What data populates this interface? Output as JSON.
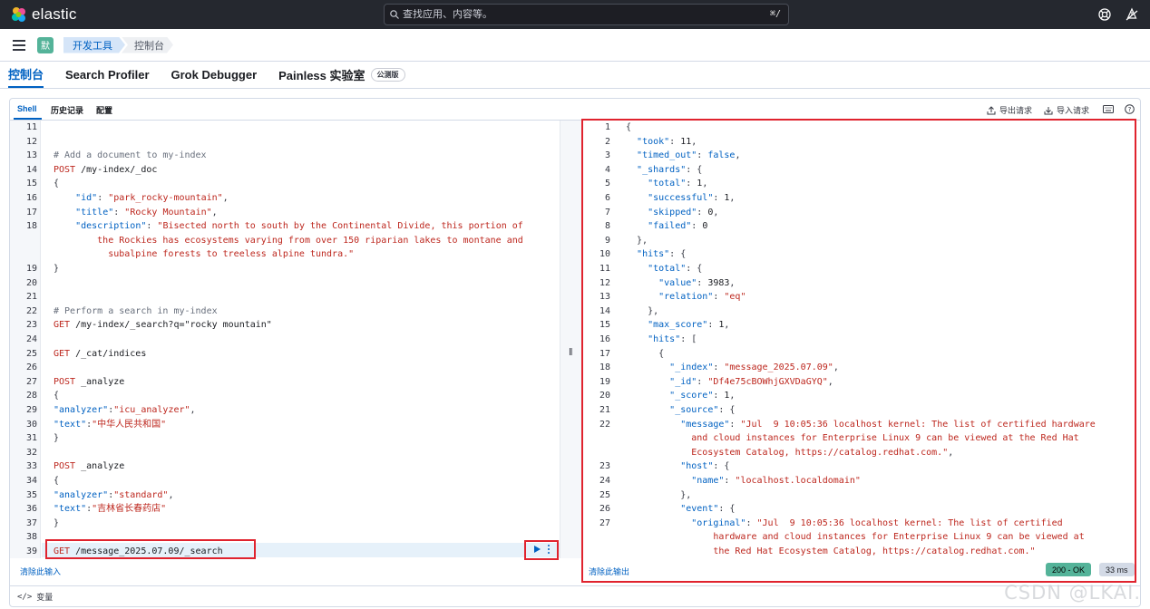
{
  "app": {
    "logo_text": "elastic"
  },
  "search": {
    "placeholder": "查找应用、内容等。",
    "shortcut": "⌘/"
  },
  "breadcrumbs": {
    "space_initial": "默",
    "items": [
      "开发工具",
      "控制台"
    ]
  },
  "tabs": [
    {
      "label": "控制台",
      "active": true
    },
    {
      "label": "Search Profiler",
      "active": false
    },
    {
      "label": "Grok Debugger",
      "active": false
    },
    {
      "label": "Painless 实验室",
      "active": false,
      "badge": "公测版"
    }
  ],
  "console_tabs": [
    {
      "label": "Shell",
      "active": true
    },
    {
      "label": "历史记录",
      "active": false
    },
    {
      "label": "配置",
      "active": false
    }
  ],
  "console_actions": {
    "export": "导出请求",
    "import": "导入请求"
  },
  "editor": {
    "lines": [
      {
        "n": "11",
        "segs": []
      },
      {
        "n": "12",
        "segs": []
      },
      {
        "n": "13",
        "segs": [
          [
            "c-comment",
            "# Add a document to my-index"
          ]
        ]
      },
      {
        "n": "14",
        "segs": [
          [
            "c-method",
            "POST"
          ],
          [
            "c-url",
            " /my-index/_doc"
          ]
        ]
      },
      {
        "n": "15",
        "segs": [
          [
            "c-punc",
            "{"
          ]
        ]
      },
      {
        "n": "16",
        "segs": [
          [
            "c-punc",
            "    "
          ],
          [
            "c-key",
            "\"id\""
          ],
          [
            "c-punc",
            ": "
          ],
          [
            "c-str",
            "\"park_rocky-mountain\""
          ],
          [
            "c-punc",
            ","
          ]
        ]
      },
      {
        "n": "17",
        "segs": [
          [
            "c-punc",
            "    "
          ],
          [
            "c-key",
            "\"title\""
          ],
          [
            "c-punc",
            ": "
          ],
          [
            "c-str",
            "\"Rocky Mountain\""
          ],
          [
            "c-punc",
            ","
          ]
        ]
      },
      {
        "n": "18",
        "segs": [
          [
            "c-punc",
            "    "
          ],
          [
            "c-key",
            "\"description\""
          ],
          [
            "c-punc",
            ": "
          ],
          [
            "c-str",
            "\"Bisected north to south by the Continental Divide, this portion of"
          ]
        ]
      },
      {
        "n": "",
        "segs": [
          [
            "c-str",
            "        the Rockies has ecosystems varying from over 150 riparian lakes to montane and"
          ]
        ]
      },
      {
        "n": "",
        "segs": [
          [
            "c-str",
            "          subalpine forests to treeless alpine tundra.\""
          ]
        ]
      },
      {
        "n": "19",
        "segs": [
          [
            "c-punc",
            "}"
          ]
        ]
      },
      {
        "n": "20",
        "segs": []
      },
      {
        "n": "21",
        "segs": []
      },
      {
        "n": "22",
        "segs": [
          [
            "c-comment",
            "# Perform a search in my-index"
          ]
        ]
      },
      {
        "n": "23",
        "segs": [
          [
            "c-method",
            "GET"
          ],
          [
            "c-url",
            " /my-index/_search?q=\"rocky mountain\""
          ]
        ]
      },
      {
        "n": "24",
        "segs": []
      },
      {
        "n": "25",
        "segs": [
          [
            "c-method",
            "GET"
          ],
          [
            "c-url",
            " /_cat/indices"
          ]
        ]
      },
      {
        "n": "26",
        "segs": []
      },
      {
        "n": "27",
        "segs": [
          [
            "c-method",
            "POST"
          ],
          [
            "c-url",
            " _analyze"
          ]
        ]
      },
      {
        "n": "28",
        "segs": [
          [
            "c-punc",
            "{"
          ]
        ]
      },
      {
        "n": "29",
        "segs": [
          [
            "c-key",
            "\"analyzer\""
          ],
          [
            "c-punc",
            ":"
          ],
          [
            "c-str",
            "\"icu_analyzer\""
          ],
          [
            "c-punc",
            ","
          ]
        ]
      },
      {
        "n": "30",
        "segs": [
          [
            "c-key",
            "\"text\""
          ],
          [
            "c-punc",
            ":"
          ],
          [
            "c-str",
            "\"中华人民共和国\""
          ]
        ]
      },
      {
        "n": "31",
        "segs": [
          [
            "c-punc",
            "}"
          ]
        ]
      },
      {
        "n": "32",
        "segs": []
      },
      {
        "n": "33",
        "segs": [
          [
            "c-method",
            "POST"
          ],
          [
            "c-url",
            " _analyze"
          ]
        ]
      },
      {
        "n": "34",
        "segs": [
          [
            "c-punc",
            "{"
          ]
        ]
      },
      {
        "n": "35",
        "segs": [
          [
            "c-key",
            "\"analyzer\""
          ],
          [
            "c-punc",
            ":"
          ],
          [
            "c-str",
            "\"standard\""
          ],
          [
            "c-punc",
            ","
          ]
        ]
      },
      {
        "n": "36",
        "segs": [
          [
            "c-key",
            "\"text\""
          ],
          [
            "c-punc",
            ":"
          ],
          [
            "c-str",
            "\"吉林省长春药店\""
          ]
        ]
      },
      {
        "n": "37",
        "segs": [
          [
            "c-punc",
            "}"
          ]
        ]
      },
      {
        "n": "38",
        "segs": []
      },
      {
        "n": "39",
        "segs": [
          [
            "c-method",
            "GET"
          ],
          [
            "c-url",
            " /message_2025.07.09/_search"
          ]
        ]
      }
    ],
    "clear_label": "清除此输入"
  },
  "output": {
    "lines": [
      {
        "n": "1",
        "segs": [
          [
            "c-punc",
            "{"
          ]
        ]
      },
      {
        "n": "2",
        "segs": [
          [
            "c-punc",
            "  "
          ],
          [
            "c-key",
            "\"took\""
          ],
          [
            "c-punc",
            ": "
          ],
          [
            "c-num",
            "11"
          ],
          [
            "c-punc",
            ","
          ]
        ]
      },
      {
        "n": "3",
        "segs": [
          [
            "c-punc",
            "  "
          ],
          [
            "c-key",
            "\"timed_out\""
          ],
          [
            "c-punc",
            ": "
          ],
          [
            "c-bool",
            "false"
          ],
          [
            "c-punc",
            ","
          ]
        ]
      },
      {
        "n": "4",
        "segs": [
          [
            "c-punc",
            "  "
          ],
          [
            "c-key",
            "\"_shards\""
          ],
          [
            "c-punc",
            ": {"
          ]
        ]
      },
      {
        "n": "5",
        "segs": [
          [
            "c-punc",
            "    "
          ],
          [
            "c-key",
            "\"total\""
          ],
          [
            "c-punc",
            ": "
          ],
          [
            "c-num",
            "1"
          ],
          [
            "c-punc",
            ","
          ]
        ]
      },
      {
        "n": "6",
        "segs": [
          [
            "c-punc",
            "    "
          ],
          [
            "c-key",
            "\"successful\""
          ],
          [
            "c-punc",
            ": "
          ],
          [
            "c-num",
            "1"
          ],
          [
            "c-punc",
            ","
          ]
        ]
      },
      {
        "n": "7",
        "segs": [
          [
            "c-punc",
            "    "
          ],
          [
            "c-key",
            "\"skipped\""
          ],
          [
            "c-punc",
            ": "
          ],
          [
            "c-num",
            "0"
          ],
          [
            "c-punc",
            ","
          ]
        ]
      },
      {
        "n": "8",
        "segs": [
          [
            "c-punc",
            "    "
          ],
          [
            "c-key",
            "\"failed\""
          ],
          [
            "c-punc",
            ": "
          ],
          [
            "c-num",
            "0"
          ]
        ]
      },
      {
        "n": "9",
        "segs": [
          [
            "c-punc",
            "  },"
          ]
        ]
      },
      {
        "n": "10",
        "segs": [
          [
            "c-punc",
            "  "
          ],
          [
            "c-key",
            "\"hits\""
          ],
          [
            "c-punc",
            ": {"
          ]
        ]
      },
      {
        "n": "11",
        "segs": [
          [
            "c-punc",
            "    "
          ],
          [
            "c-key",
            "\"total\""
          ],
          [
            "c-punc",
            ": {"
          ]
        ]
      },
      {
        "n": "12",
        "segs": [
          [
            "c-punc",
            "      "
          ],
          [
            "c-key",
            "\"value\""
          ],
          [
            "c-punc",
            ": "
          ],
          [
            "c-num",
            "3983"
          ],
          [
            "c-punc",
            ","
          ]
        ]
      },
      {
        "n": "13",
        "segs": [
          [
            "c-punc",
            "      "
          ],
          [
            "c-key",
            "\"relation\""
          ],
          [
            "c-punc",
            ": "
          ],
          [
            "c-str",
            "\"eq\""
          ]
        ]
      },
      {
        "n": "14",
        "segs": [
          [
            "c-punc",
            "    },"
          ]
        ]
      },
      {
        "n": "15",
        "segs": [
          [
            "c-punc",
            "    "
          ],
          [
            "c-key",
            "\"max_score\""
          ],
          [
            "c-punc",
            ": "
          ],
          [
            "c-num",
            "1"
          ],
          [
            "c-punc",
            ","
          ]
        ]
      },
      {
        "n": "16",
        "segs": [
          [
            "c-punc",
            "    "
          ],
          [
            "c-key",
            "\"hits\""
          ],
          [
            "c-punc",
            ": ["
          ]
        ]
      },
      {
        "n": "17",
        "segs": [
          [
            "c-punc",
            "      {"
          ]
        ]
      },
      {
        "n": "18",
        "segs": [
          [
            "c-punc",
            "        "
          ],
          [
            "c-key",
            "\"_index\""
          ],
          [
            "c-punc",
            ": "
          ],
          [
            "c-str",
            "\"message_2025.07.09\""
          ],
          [
            "c-punc",
            ","
          ]
        ]
      },
      {
        "n": "19",
        "segs": [
          [
            "c-punc",
            "        "
          ],
          [
            "c-key",
            "\"_id\""
          ],
          [
            "c-punc",
            ": "
          ],
          [
            "c-str",
            "\"Df4e75cBOWhjGXVDaGYQ\""
          ],
          [
            "c-punc",
            ","
          ]
        ]
      },
      {
        "n": "20",
        "segs": [
          [
            "c-punc",
            "        "
          ],
          [
            "c-key",
            "\"_score\""
          ],
          [
            "c-punc",
            ": "
          ],
          [
            "c-num",
            "1"
          ],
          [
            "c-punc",
            ","
          ]
        ]
      },
      {
        "n": "21",
        "segs": [
          [
            "c-punc",
            "        "
          ],
          [
            "c-key",
            "\"_source\""
          ],
          [
            "c-punc",
            ": {"
          ]
        ]
      },
      {
        "n": "22",
        "segs": [
          [
            "c-punc",
            "          "
          ],
          [
            "c-key",
            "\"message\""
          ],
          [
            "c-punc",
            ": "
          ],
          [
            "c-str",
            "\"Jul  9 10:05:36 localhost kernel: The list of certified hardware"
          ]
        ]
      },
      {
        "n": "",
        "segs": [
          [
            "c-str",
            "            and cloud instances for Enterprise Linux 9 can be viewed at the Red Hat"
          ]
        ]
      },
      {
        "n": "",
        "segs": [
          [
            "c-str",
            "            Ecosystem Catalog, https://catalog.redhat.com.\""
          ],
          [
            "c-punc",
            ","
          ]
        ]
      },
      {
        "n": "23",
        "segs": [
          [
            "c-punc",
            "          "
          ],
          [
            "c-key",
            "\"host\""
          ],
          [
            "c-punc",
            ": {"
          ]
        ]
      },
      {
        "n": "24",
        "segs": [
          [
            "c-punc",
            "            "
          ],
          [
            "c-key",
            "\"name\""
          ],
          [
            "c-punc",
            ": "
          ],
          [
            "c-str",
            "\"localhost.localdomain\""
          ]
        ]
      },
      {
        "n": "25",
        "segs": [
          [
            "c-punc",
            "          },"
          ]
        ]
      },
      {
        "n": "26",
        "segs": [
          [
            "c-punc",
            "          "
          ],
          [
            "c-key",
            "\"event\""
          ],
          [
            "c-punc",
            ": {"
          ]
        ]
      },
      {
        "n": "27",
        "segs": [
          [
            "c-punc",
            "            "
          ],
          [
            "c-key",
            "\"original\""
          ],
          [
            "c-punc",
            ": "
          ],
          [
            "c-str",
            "\"Jul  9 10:05:36 localhost kernel: The list of certified"
          ]
        ]
      },
      {
        "n": "",
        "segs": [
          [
            "c-str",
            "                hardware and cloud instances for Enterprise Linux 9 can be viewed at"
          ]
        ]
      },
      {
        "n": "",
        "segs": [
          [
            "c-str",
            "                the Red Hat Ecosystem Catalog, https://catalog.redhat.com.\""
          ]
        ]
      }
    ],
    "clear_label": "清除此输出",
    "status": "200 - OK",
    "time": "33 ms"
  },
  "variables_label": "变量",
  "watermark": "CSDN @LKAI."
}
